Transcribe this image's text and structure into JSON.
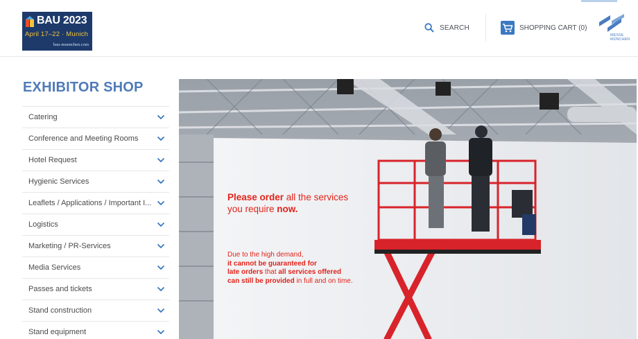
{
  "header": {
    "logo": {
      "title": "BAU 2023",
      "dates": "April 17–22 · Munich",
      "url": "bau-muenchen.com"
    },
    "search_label": "SEARCH",
    "cart_label": "SHOPPING CART (0)",
    "messe_label_1": "MESSE",
    "messe_label_2": "MÜNCHEN"
  },
  "sidebar": {
    "title": "EXHIBITOR SHOP",
    "items": [
      {
        "label": "Catering"
      },
      {
        "label": "Conference and Meeting Rooms"
      },
      {
        "label": "Hotel Request"
      },
      {
        "label": "Hygienic Services"
      },
      {
        "label": "Leaflets / Applications / Important I..."
      },
      {
        "label": "Logistics"
      },
      {
        "label": "Marketing / PR-Services"
      },
      {
        "label": "Media Services"
      },
      {
        "label": "Passes and tickets"
      },
      {
        "label": "Stand construction"
      },
      {
        "label": "Stand equipment"
      }
    ]
  },
  "hero": {
    "line1_bold": "Please order",
    "line1_rest": " all the services",
    "line2_pre": "you require ",
    "line2_bold": "now.",
    "note1": "Due to the high demand,",
    "note2": "it cannot be guaranteed for",
    "note3_bold": "late orders",
    "note3_mid": " that ",
    "note3_bold2": "all services offered",
    "note4_bold": "can still be provided",
    "note4_rest": " in full and on time."
  },
  "colors": {
    "brand_blue": "#4f7ab8",
    "logo_navy": "#1d3a6b",
    "accent_red": "#e2231a",
    "chevron_blue": "#3b78c2"
  },
  "icons": {
    "search": "search-icon",
    "cart": "shopping-cart-icon",
    "chevron": "chevron-down-icon"
  }
}
